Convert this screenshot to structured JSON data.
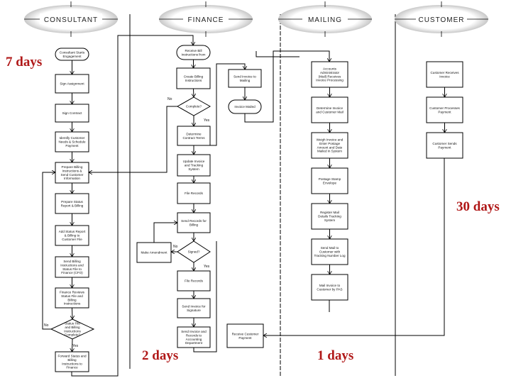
{
  "lanes": [
    "CONSULTANT",
    "FINANCE",
    "MAILING",
    "CUSTOMER"
  ],
  "durations": {
    "consultant": "7 days",
    "customer": "30 days",
    "finance": "2 days",
    "mailing": "1 days"
  },
  "branch_labels": {
    "no": "No",
    "yes": "Yes"
  },
  "colors": {
    "duration_text": "#b01818",
    "header_swoosh": "#c8c8c8",
    "lines": "#000000"
  },
  "nodes": {
    "c1": "Consultant Starts Engagement",
    "c2": "Sign Assignment",
    "c3": "Sign Contract",
    "c4": "Identify Customer Needs & Schedule Payment",
    "c5": "Prepare Billing Instructions & Send Customer Information",
    "c6": "Prepare Status Report & Billing",
    "c7": "Add Status Report & Billing to Customer File",
    "c8": "Send Billing Instructions and Status File to Finance (CFO)",
    "c9": "Finance Reviews Status File and Billing Instructions",
    "c10": "Status File and Billing Instructions Complete?",
    "c11": "Forward Status and Billing Instructions to Finance",
    "f1": "Receive Bill Instructions from",
    "f2": "Create Billing Instructions",
    "f3": "Complete?",
    "f4": "Determine Contract Terms",
    "f5": "Update Invoice and Tracking System",
    "f6": "File Records",
    "f7": "Send Records for Billing",
    "f8": "Signed?",
    "f9": "Make Amendment",
    "f10": "File Records",
    "f11": "Send Invoice for Signature",
    "f12": "Send Invoice and Records to Accounting Department",
    "m0": "Send Invoice to Mailing",
    "m00": "Invoice Mailed",
    "m1": "Accounts Administrator (Mail) Receives Invoice Processing",
    "m2": "Determine Invoice and Customer Mail",
    "m3": "Weigh Invoice and Enter Postage Amount and Date Mailed in System",
    "m4": "Postage Stamp Envelope",
    "m5": "Register Mail Details Tracking System",
    "m6": "Send Mail to Customer with Tracking Number Log",
    "m7": "Mail Invoice to Customer by PAS",
    "m8": "Receive Customer Payment",
    "u1": "Customer Receives Invoice",
    "u2": "Customer Processes Payment",
    "u3": "Customer Sends Payment"
  }
}
